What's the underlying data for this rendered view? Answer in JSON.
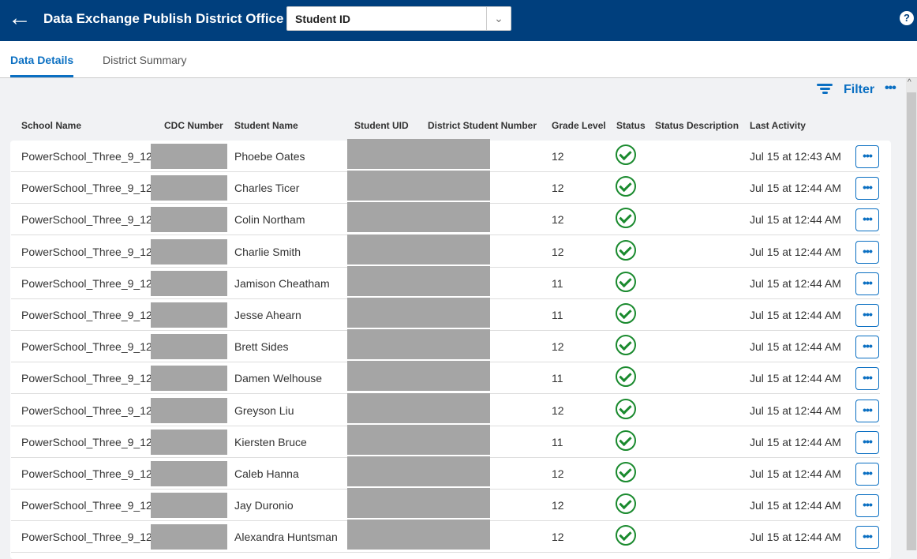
{
  "header": {
    "back_icon": "arrow-left-icon",
    "title": "Data Exchange Publish",
    "context": "District Office",
    "select_value": "Student ID",
    "help_icon": "question-icon"
  },
  "tabs": [
    {
      "label": "Data Details",
      "active": true
    },
    {
      "label": "District Summary",
      "active": false
    }
  ],
  "toolbar": {
    "filter_label": "Filter",
    "more_label": "•••"
  },
  "columns": [
    "School Name",
    "CDC Number",
    "Student Name",
    "Student UID",
    "District Student Number",
    "Grade Level",
    "Status",
    "Status Description",
    "Last Activity"
  ],
  "rows": [
    {
      "school": "PowerSchool_Three_9_12",
      "name": "Phoebe Oates",
      "grade": "12",
      "status": "success",
      "activity": "Jul 15 at 12:43 AM"
    },
    {
      "school": "PowerSchool_Three_9_12",
      "name": "Charles Ticer",
      "grade": "12",
      "status": "success",
      "activity": "Jul 15 at 12:44 AM"
    },
    {
      "school": "PowerSchool_Three_9_12",
      "name": "Colin Northam",
      "grade": "12",
      "status": "success",
      "activity": "Jul 15 at 12:44 AM"
    },
    {
      "school": "PowerSchool_Three_9_12",
      "name": "Charlie Smith",
      "grade": "12",
      "status": "success",
      "activity": "Jul 15 at 12:44 AM"
    },
    {
      "school": "PowerSchool_Three_9_12",
      "name": "Jamison Cheatham",
      "grade": "11",
      "status": "success",
      "activity": "Jul 15 at 12:44 AM"
    },
    {
      "school": "PowerSchool_Three_9_12",
      "name": "Jesse Ahearn",
      "grade": "11",
      "status": "success",
      "activity": "Jul 15 at 12:44 AM"
    },
    {
      "school": "PowerSchool_Three_9_12",
      "name": "Brett Sides",
      "grade": "12",
      "status": "success",
      "activity": "Jul 15 at 12:44 AM"
    },
    {
      "school": "PowerSchool_Three_9_12",
      "name": "Damen Welhouse",
      "grade": "11",
      "status": "success",
      "activity": "Jul 15 at 12:44 AM"
    },
    {
      "school": "PowerSchool_Three_9_12",
      "name": "Greyson Liu",
      "grade": "12",
      "status": "success",
      "activity": "Jul 15 at 12:44 AM"
    },
    {
      "school": "PowerSchool_Three_9_12",
      "name": "Kiersten Bruce",
      "grade": "11",
      "status": "success",
      "activity": "Jul 15 at 12:44 AM"
    },
    {
      "school": "PowerSchool_Three_9_12",
      "name": "Caleb Hanna",
      "grade": "12",
      "status": "success",
      "activity": "Jul 15 at 12:44 AM"
    },
    {
      "school": "PowerSchool_Three_9_12",
      "name": "Jay Duronio",
      "grade": "12",
      "status": "success",
      "activity": "Jul 15 at 12:44 AM"
    },
    {
      "school": "PowerSchool_Three_9_12",
      "name": "Alexandra Huntsman",
      "grade": "12",
      "status": "success",
      "activity": "Jul 15 at 12:44 AM"
    }
  ],
  "row_action_label": "•••",
  "colors": {
    "header": "#003f7d",
    "accent": "#0a6fc2",
    "success": "#1a8a2e"
  }
}
